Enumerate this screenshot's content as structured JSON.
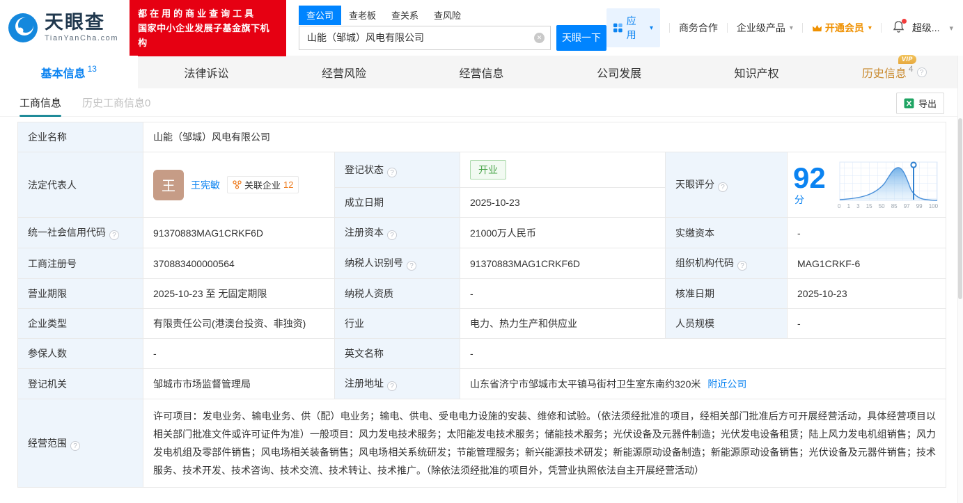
{
  "header": {
    "logo": {
      "brand": "天眼查",
      "domain": "TianYanCha.com"
    },
    "slogan_line1": "都在用的商业查询工具",
    "slogan_line2": "国家中小企业发展子基金旗下机构",
    "search": {
      "tabs": [
        {
          "label": "查公司",
          "active": true
        },
        {
          "label": "查老板",
          "active": false
        },
        {
          "label": "查关系",
          "active": false
        },
        {
          "label": "查风险",
          "active": false
        }
      ],
      "value": "山能（邹城）风电有限公司",
      "button": "天眼一下"
    },
    "nav": {
      "apps": "应用",
      "business": "商务合作",
      "enterprise": "企业级产品",
      "vip": "开通会员",
      "user": "超级..."
    }
  },
  "tabs": [
    {
      "label": "基本信息",
      "count": "13"
    },
    {
      "label": "法律诉讼"
    },
    {
      "label": "经营风险"
    },
    {
      "label": "经营信息"
    },
    {
      "label": "公司发展"
    },
    {
      "label": "知识产权"
    },
    {
      "label": "历史信息",
      "count": "4",
      "vip_badge": "VIP"
    }
  ],
  "subtabs": {
    "active": "工商信息",
    "inactive": "历史工商信息0",
    "export": "导出"
  },
  "table": {
    "company_name": {
      "label": "企业名称",
      "value": "山能（邹城）风电有限公司"
    },
    "legal_rep": {
      "label": "法定代表人",
      "avatar": "王",
      "name": "王宪敏",
      "related_label": "关联企业",
      "related_count": "12"
    },
    "reg_status": {
      "label": "登记状态",
      "value": "开业"
    },
    "est_date": {
      "label": "成立日期",
      "value": "2025-10-23"
    },
    "score": {
      "label": "天眼评分",
      "value": "92",
      "unit": "分",
      "ticks": [
        "0",
        "1",
        "3",
        "15",
        "50",
        "85",
        "97",
        "99",
        "100"
      ]
    },
    "credit_code": {
      "label": "统一社会信用代码",
      "value": "91370883MAG1CRKF6D"
    },
    "reg_capital": {
      "label": "注册资本",
      "value": "21000万人民币"
    },
    "paid_capital": {
      "label": "实缴资本",
      "value": "-"
    },
    "reg_number": {
      "label": "工商注册号",
      "value": "370883400000564"
    },
    "taxpayer_id": {
      "label": "纳税人识别号",
      "value": "91370883MAG1CRKF6D"
    },
    "org_code": {
      "label": "组织机构代码",
      "value": "MAG1CRKF-6"
    },
    "business_term": {
      "label": "营业期限",
      "value": "2025-10-23 至 无固定期限"
    },
    "taxpayer_quality": {
      "label": "纳税人资质",
      "value": "-"
    },
    "approval_date": {
      "label": "核准日期",
      "value": "2025-10-23"
    },
    "company_type": {
      "label": "企业类型",
      "value": "有限责任公司(港澳台投资、非独资)"
    },
    "industry": {
      "label": "行业",
      "value": "电力、热力生产和供应业"
    },
    "staff_size": {
      "label": "人员规模",
      "value": "-"
    },
    "insured_count": {
      "label": "参保人数",
      "value": "-"
    },
    "english_name": {
      "label": "英文名称",
      "value": "-"
    },
    "reg_authority": {
      "label": "登记机关",
      "value": "邹城市市场监督管理局"
    },
    "reg_address": {
      "label": "注册地址",
      "value": "山东省济宁市邹城市太平镇马街村卫生室东南约320米",
      "link": "附近公司"
    },
    "business_scope": {
      "label": "经营范围",
      "value": "许可项目：发电业务、输电业务、供（配）电业务；输电、供电、受电电力设施的安装、维修和试验。（依法须经批准的项目，经相关部门批准后方可开展经营活动，具体经营项目以相关部门批准文件或许可证件为准）一般项目：风力发电技术服务；太阳能发电技术服务；储能技术服务；光伏设备及元器件制造；光伏发电设备租赁；陆上风力发电机组销售；风力发电机组及零部件销售；风电场相关装备销售；风电场相关系统研发；节能管理服务；新兴能源技术研发；新能源原动设备制造；新能源原动设备销售；光伏设备及元器件销售；技术服务、技术开发、技术咨询、技术交流、技术转让、技术推广。（除依法须经批准的项目外，凭营业执照依法自主开展经营活动）"
    }
  },
  "colors": {
    "brand_blue": "#0084ff",
    "slogan_red": "#e60012",
    "vip_orange": "#ef9102",
    "status_green": "#4ba54b",
    "subtab_teal": "#1f8b99"
  }
}
